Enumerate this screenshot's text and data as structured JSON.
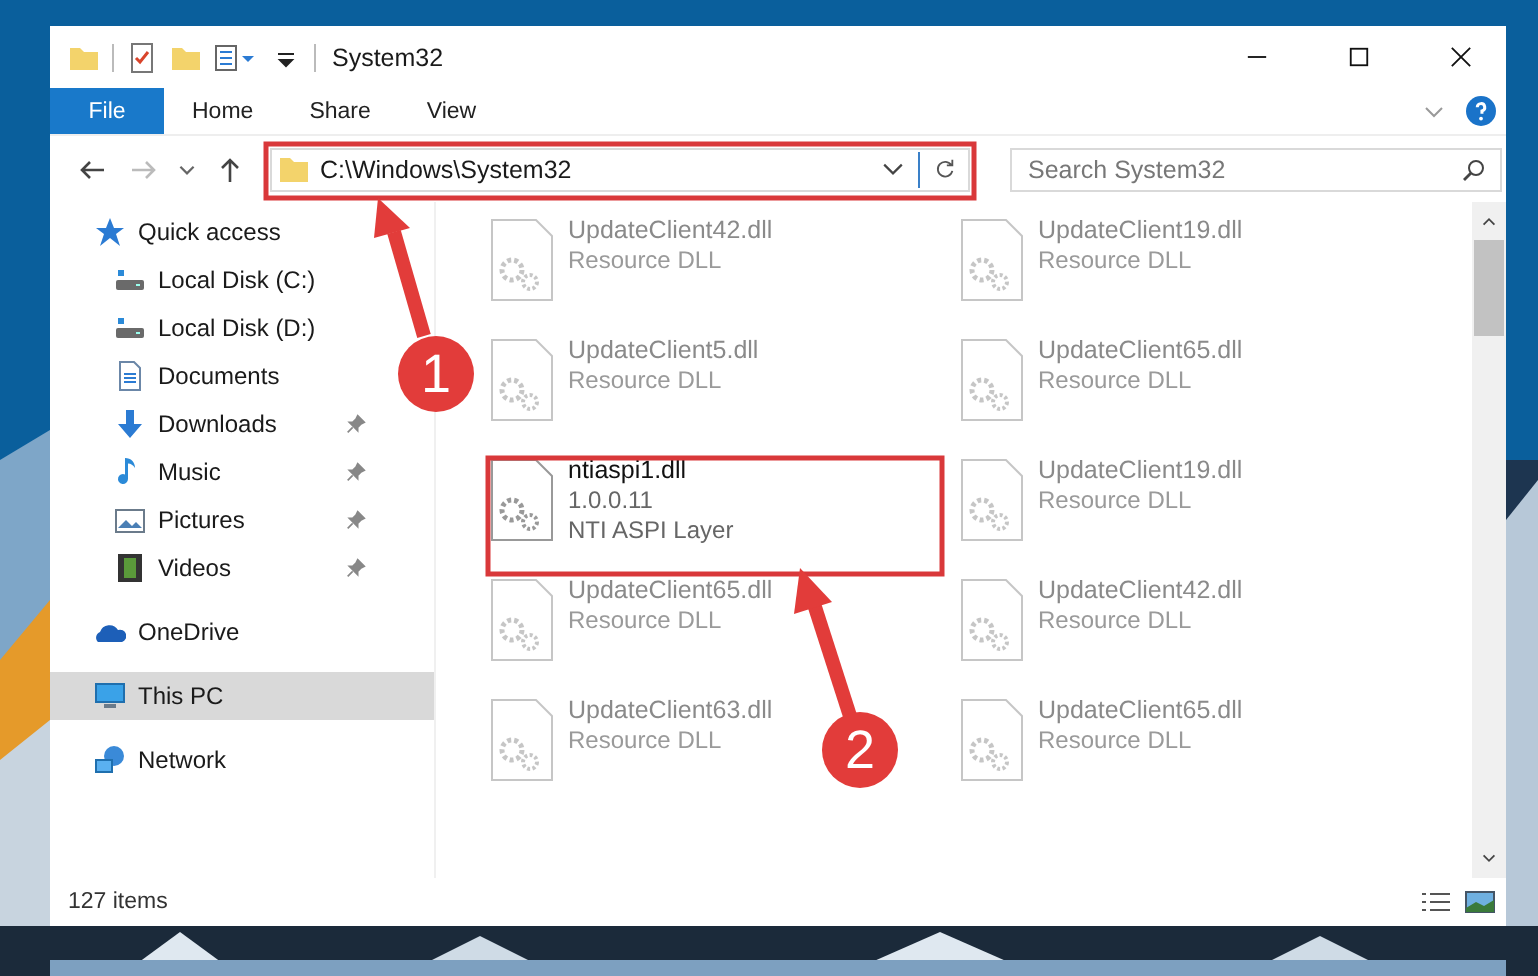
{
  "window": {
    "title": "System32"
  },
  "ribbon_tabs": [
    {
      "label": "File",
      "kind": "menu"
    },
    {
      "label": "Home",
      "kind": "tab"
    },
    {
      "label": "Share",
      "kind": "tab"
    },
    {
      "label": "View",
      "kind": "tab"
    }
  ],
  "address_bar": {
    "value": "C:\\Windows\\System32"
  },
  "search": {
    "placeholder": "Search System32"
  },
  "sidebar": {
    "items": [
      {
        "label": "Quick access",
        "kind": "quick",
        "selected": false,
        "children": [
          {
            "label": "Local Disk (C:)",
            "kind": "drive",
            "pinned": false
          },
          {
            "label": "Local Disk (D:)",
            "kind": "drive",
            "pinned": false
          },
          {
            "label": "Documents",
            "kind": "documents",
            "pinned": false
          },
          {
            "label": "Downloads",
            "kind": "downloads",
            "pinned": true
          },
          {
            "label": "Music",
            "kind": "music",
            "pinned": true
          },
          {
            "label": "Pictures",
            "kind": "pictures",
            "pinned": true
          },
          {
            "label": "Videos",
            "kind": "videos",
            "pinned": true
          }
        ]
      },
      {
        "label": "OneDrive",
        "kind": "onedrive",
        "selected": false
      },
      {
        "label": "This PC",
        "kind": "pc",
        "selected": true
      },
      {
        "label": "Network",
        "kind": "network",
        "selected": false
      }
    ]
  },
  "files": [
    {
      "name": "UpdateClient42.dll",
      "description": "Resource DLL",
      "blurred": true
    },
    {
      "name": "UpdateClient19.dll",
      "description": "Resource DLL",
      "blurred": true
    },
    {
      "name": "UpdateClient5.dll",
      "description": "Resource DLL",
      "blurred": true
    },
    {
      "name": "UpdateClient65.dll",
      "description": "Resource DLL",
      "blurred": true
    },
    {
      "name": "ntiaspi1.dll",
      "version": "1.0.0.11",
      "description": "NTI ASPI Layer",
      "blurred": false
    },
    {
      "name": "UpdateClient19.dll",
      "description": "Resource DLL",
      "blurred": true
    },
    {
      "name": "UpdateClient65.dll",
      "description": "Resource DLL",
      "blurred": true
    },
    {
      "name": "UpdateClient42.dll",
      "description": "Resource DLL",
      "blurred": true
    },
    {
      "name": "UpdateClient63.dll",
      "description": "Resource DLL",
      "blurred": true
    },
    {
      "name": "UpdateClient65.dll",
      "description": "Resource DLL",
      "blurred": true
    }
  ],
  "status_bar": {
    "item_count": "127 items"
  },
  "annotations": [
    {
      "number": "1"
    },
    {
      "number": "2"
    }
  ]
}
